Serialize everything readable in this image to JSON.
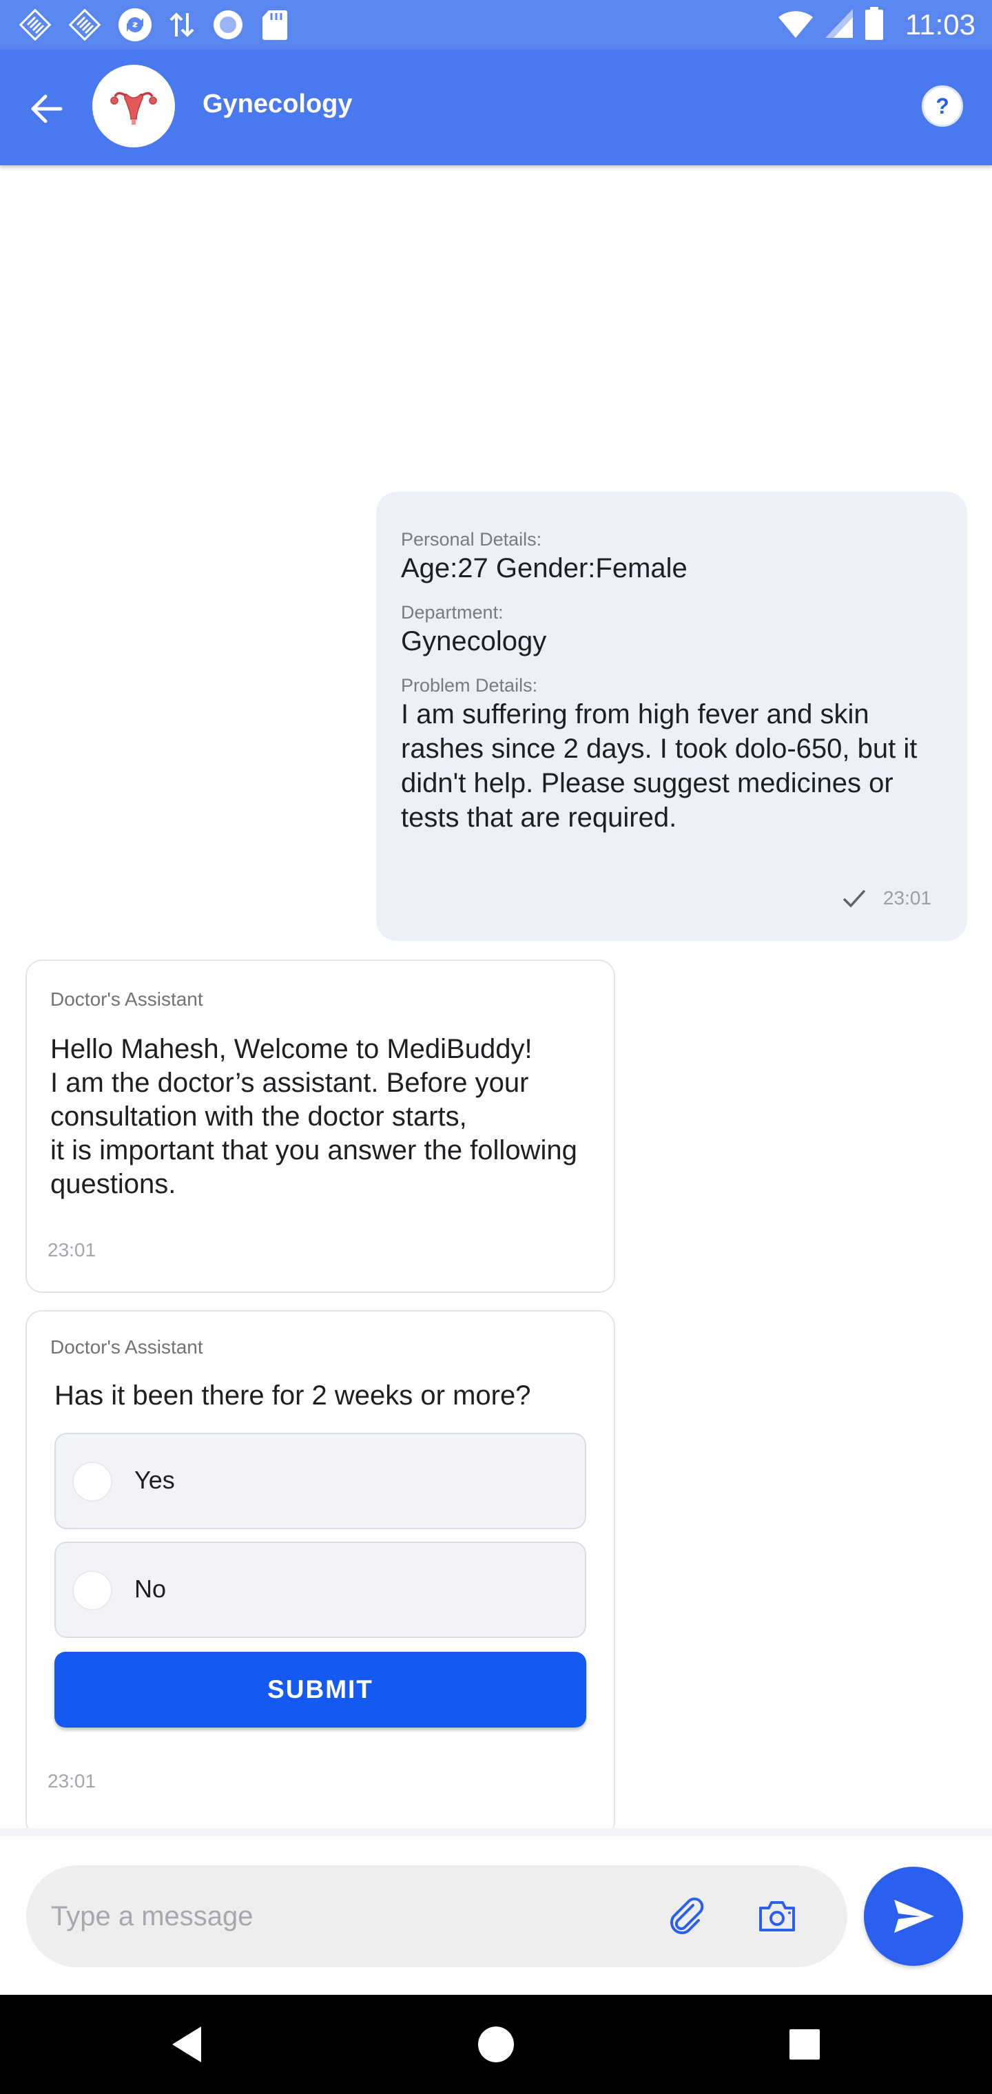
{
  "status_bar": {
    "time": "11:03",
    "icons": [
      "app-notification-icon",
      "app-notification-icon",
      "sync-icon",
      "data-transfer-icon",
      "circle-app-icon",
      "sd-card-icon",
      "wifi-icon",
      "cell-signal-icon",
      "battery-icon"
    ]
  },
  "header": {
    "title": "Gynecology",
    "back_icon": "back-arrow-icon",
    "avatar_icon": "uterus-icon",
    "help_label": "?"
  },
  "sent_message": {
    "details": [
      {
        "label": "Personal Details:",
        "value": "Age:27 Gender:Female"
      },
      {
        "label": "Department:",
        "value": "Gynecology"
      },
      {
        "label": "Problem Details:",
        "value": "I am suffering from high fever and skin rashes since 2 days. I took dolo-650, but it didn't help. Please suggest medicines or tests that are required."
      }
    ],
    "time": "23:01",
    "status_icon": "checkmark-icon"
  },
  "welcome_message": {
    "author": "Doctor's Assistant",
    "text": "Hello Mahesh, Welcome to MediBuddy!\nI am the doctor’s assistant. Before your consultation with the doctor starts,\nit is important that you answer the following questions.",
    "time": "23:01"
  },
  "question_message": {
    "author": "Doctor's Assistant",
    "question": "Has it been there for 2 weeks or more?",
    "options": [
      {
        "label": "Yes",
        "selected": false
      },
      {
        "label": "No",
        "selected": false
      }
    ],
    "submit_label": "SUBMIT",
    "time": "23:01"
  },
  "composer": {
    "placeholder": "Type a message",
    "value": "",
    "attach_icon": "paperclip-icon",
    "camera_icon": "camera-icon",
    "send_icon": "send-icon"
  },
  "nav_bar": {
    "icons": [
      "back-triangle-icon",
      "home-circle-icon",
      "recents-square-icon"
    ]
  },
  "colors": {
    "status_bar": "#5a86ef",
    "header": "#4a78ee",
    "accent": "#1459f2",
    "sent_bubble": "#eef0f8"
  }
}
